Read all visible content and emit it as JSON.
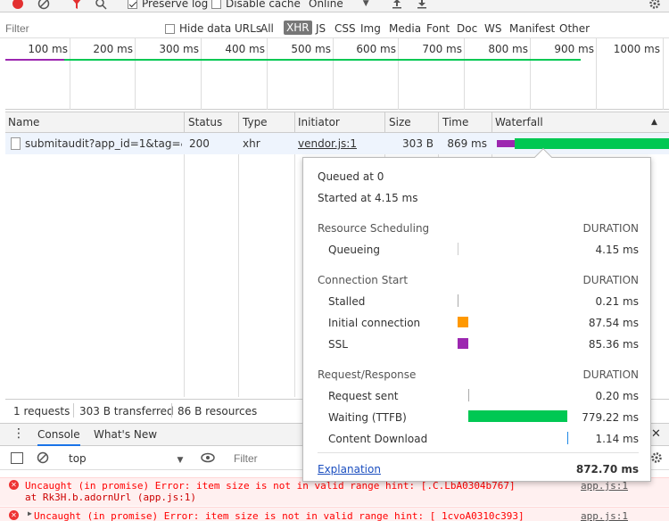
{
  "toolbar": {
    "preserve_log": "Preserve log",
    "disable_cache": "Disable cache",
    "throttle": "Online"
  },
  "filterbar": {
    "filter_placeholder": "Filter",
    "hide_data_urls": "Hide data URLs",
    "types": [
      "All",
      "XHR",
      "JS",
      "CSS",
      "Img",
      "Media",
      "Font",
      "Doc",
      "WS",
      "Manifest",
      "Other"
    ],
    "active_type": "XHR"
  },
  "timeline": {
    "labels": [
      "100 ms",
      "200 ms",
      "300 ms",
      "400 ms",
      "500 ms",
      "600 ms",
      "700 ms",
      "800 ms",
      "900 ms",
      "1000 ms"
    ]
  },
  "table": {
    "headers": {
      "name": "Name",
      "status": "Status",
      "type": "Type",
      "initiator": "Initiator",
      "size": "Size",
      "time": "Time",
      "waterfall": "Waterfall"
    },
    "rows": [
      {
        "name": "submitaudit?app_id=1&tag=&...",
        "status": "200",
        "type": "xhr",
        "initiator": "vendor.js:1",
        "size": "303 B",
        "time": "869 ms"
      }
    ]
  },
  "statusbar": {
    "requests": "1 requests",
    "transferred": "303 B transferred",
    "resources": "86 B resources"
  },
  "drawer": {
    "tabs": [
      "Console",
      "What's New"
    ],
    "context": "top",
    "filter_placeholder": "Filter"
  },
  "console": {
    "lines": [
      {
        "text": "Uncaught (in promise) Error: item size is not in valid range hint: [.C.LbA0304b767]",
        "source": "app.js:1"
      },
      {
        "text": "    at Rk3H.b.adornUrl (app.js:1)",
        "source": ""
      },
      {
        "text": "Uncaught (in promise) Error: item size is not in valid range hint: [_1cvoA0310c393]",
        "source": "app.js:1"
      }
    ]
  },
  "timing": {
    "queued_at": "Queued at 0",
    "started_at": "Started at 4.15 ms",
    "duration_label": "DURATION",
    "sections": [
      {
        "title": "Resource Scheduling",
        "items": [
          {
            "label": "Queueing",
            "value": "4.15 ms"
          }
        ]
      },
      {
        "title": "Connection Start",
        "items": [
          {
            "label": "Stalled",
            "value": "0.21 ms"
          },
          {
            "label": "Initial connection",
            "value": "87.54 ms"
          },
          {
            "label": "SSL",
            "value": "85.36 ms"
          }
        ]
      },
      {
        "title": "Request/Response",
        "items": [
          {
            "label": "Request sent",
            "value": "0.20 ms"
          },
          {
            "label": "Waiting (TTFB)",
            "value": "779.22 ms"
          },
          {
            "label": "Content Download",
            "value": "1.14 ms"
          }
        ]
      }
    ],
    "explanation": "Explanation",
    "total": "872.70 ms"
  },
  "colors": {
    "record": "#e33030",
    "ssl": "#9c27b0",
    "connection": "#ff9800",
    "waiting": "#00c853",
    "download": "#1e88e5",
    "link": "#1a4ebf",
    "error": "#ff0000"
  }
}
